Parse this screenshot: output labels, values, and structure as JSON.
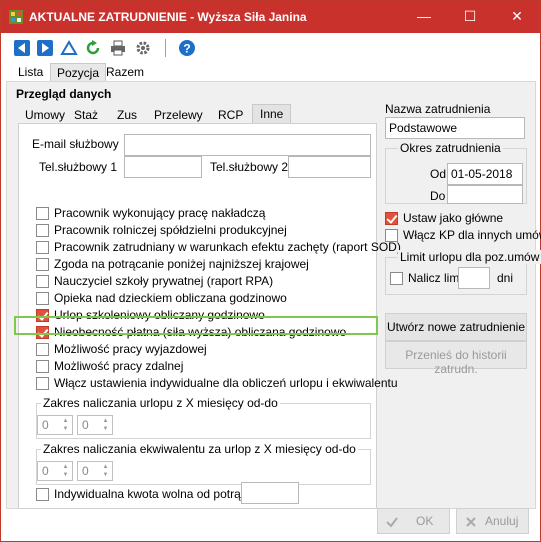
{
  "window": {
    "title": "AKTUALNE ZATRUDNIENIE - Wyższa Siła Janina",
    "minimize_glyph": "—",
    "maximize_glyph": "☐",
    "close_glyph": "✕"
  },
  "toolbar": {
    "icons": [
      "prev-icon",
      "next-icon",
      "triangle-icon",
      "refresh-icon",
      "print-icon",
      "settings-icon",
      "help-icon"
    ]
  },
  "main_tabs": [
    "Lista",
    "Pozycja",
    "Razem"
  ],
  "main_active_tab": "Pozycja",
  "group_title": "Przegląd danych",
  "sub_tabs": [
    "Umowy",
    "Staż",
    "Zus",
    "Przelewy",
    "RCP",
    "Inne"
  ],
  "sub_active_tab": "Inne",
  "contact": {
    "email_label": "E-mail służbowy",
    "email_value": "",
    "phone1_label": "Tel.służbowy 1",
    "phone1_value": "",
    "phone2_label": "Tel.służbowy 2",
    "phone2_value": ""
  },
  "checkboxes": [
    {
      "label": "Pracownik wykonujący pracę nakładczą",
      "checked": false
    },
    {
      "label": "Pracownik rolniczej spółdzielni produkcyjnej",
      "checked": false
    },
    {
      "label": "Pracownik zatrudniany w warunkach efektu zachęty (raport SOD)",
      "checked": false
    },
    {
      "label": "Zgoda na potrącanie poniżej najniższej krajowej",
      "checked": false
    },
    {
      "label": "Nauczyciel szkoły prywatnej (raport RPA)",
      "checked": false
    },
    {
      "label": "Opieka nad dzieckiem obliczana godzinowo",
      "checked": false
    },
    {
      "label": "Urlop szkoleniowy obliczany godzinowo",
      "checked": true
    },
    {
      "label": "Nieobecność płatna (siła wyższa) obliczana godzinowo",
      "checked": true
    },
    {
      "label": "Możliwość pracy wyjazdowej",
      "checked": false
    },
    {
      "label": "Możliwość pracy zdalnej",
      "checked": false
    },
    {
      "label": "Włącz ustawienia indywidualne dla obliczeń urlopu i ekwiwalentu",
      "checked": false
    }
  ],
  "range_vacation": {
    "label": "Zakres naliczania urlopu z X miesięcy od-do",
    "from": "0",
    "to": "0"
  },
  "range_equivalent": {
    "label": "Zakres naliczania ekwiwalentu za urlop z X miesięcy od-do",
    "from": "0",
    "to": "0"
  },
  "individual_amount": {
    "label": "Indywidualna kwota wolna od potrąceń",
    "value": ""
  },
  "right": {
    "employment_name_label": "Nazwa zatrudnienia",
    "employment_name_value": "Podstawowe",
    "period_title": "Okres zatrudnienia",
    "from_label": "Od",
    "from_value": "01-05-2018",
    "to_label": "Do",
    "to_value": "",
    "set_main_label": "Ustaw jako główne",
    "set_main_checked": true,
    "kp_label": "Włącz KP dla innych umów",
    "kp_checked": false,
    "limit_title": "Limit urlopu dla poz.umów",
    "limit_label": "Nalicz limit",
    "limit_value": "",
    "limit_unit": "dni",
    "new_employment_btn": "Utwórz nowe zatrudnienie",
    "move_history_btn": "Przenieś do historii zatrudn."
  },
  "footer": {
    "ok_label": "OK",
    "cancel_label": "Anuluj"
  },
  "colors": {
    "titlebar": "#c8312c",
    "accent_check": "#e0523c",
    "highlight": "#7ec850"
  }
}
